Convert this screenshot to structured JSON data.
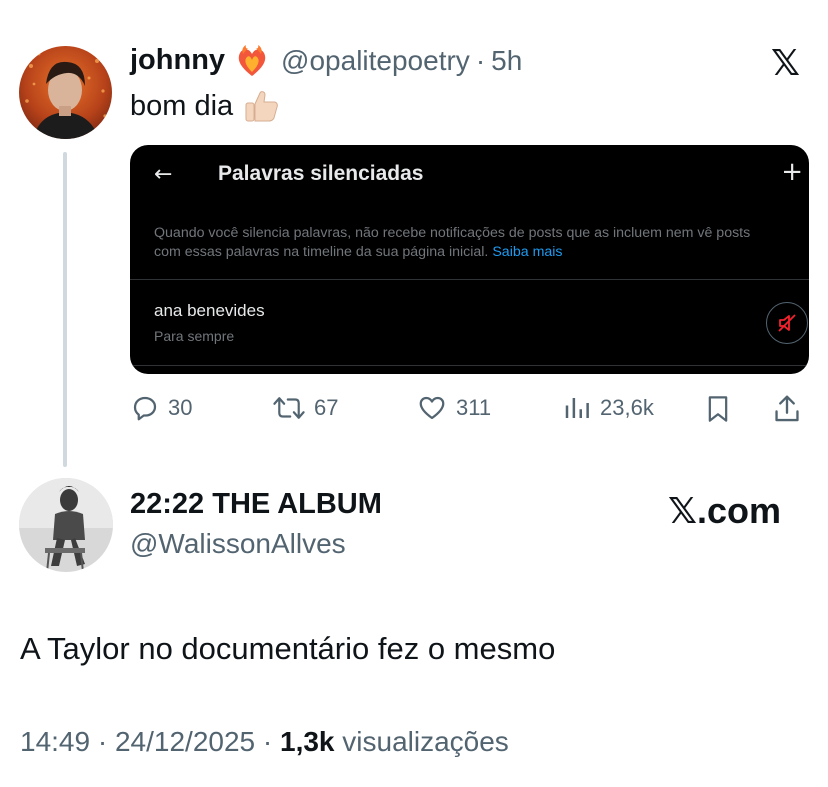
{
  "quoted_post": {
    "display_name": "johnny",
    "name_emoji": "heart-on-fire",
    "handle": "@opalitepoetry",
    "separator": "·",
    "time": "5h",
    "text": "bom dia",
    "text_emoji": "thumbs-up",
    "embed": {
      "back_icon": "←",
      "title": "Palavras silenciadas",
      "add_icon": "+",
      "description_line1": "Quando você silencia palavras, não recebe notificações de posts que as incluem nem vê posts",
      "description_line2": "com essas palavras na timeline da sua página inicial.",
      "learn_more": "Saiba mais",
      "muted_word": "ana benevides",
      "duration": "Para sempre"
    },
    "actions": {
      "replies": "30",
      "reposts": "67",
      "likes": "311",
      "views": "23,6k"
    }
  },
  "reply_post": {
    "display_name": "22:22 THE ALBUM",
    "handle": "@WalissonAllves",
    "text": "A Taylor no documentário fez o mesmo",
    "time": "14:49",
    "date": "24/12/2025",
    "separator": "·",
    "views_count": "1,3k",
    "views_label": "visualizações"
  },
  "branding": {
    "x_logo": "𝕏",
    "xcom_suffix": ".com"
  },
  "colors": {
    "text_primary": "#0f1419",
    "text_secondary": "#536471",
    "link_blue": "#1d9bf0",
    "mute_red": "#f4212e"
  }
}
